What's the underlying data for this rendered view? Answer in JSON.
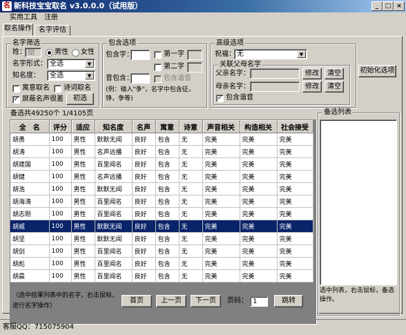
{
  "window": {
    "title": "新科技宝宝取名 v3.0.0.0（试用版）",
    "app_icon": "baby-name-app-icon",
    "minimize_glyph": "_",
    "maximize_glyph": "□",
    "close_glyph": "×"
  },
  "menu": [
    "实用工具",
    "注册"
  ],
  "tabs": [
    "取名操作",
    "名字评估"
  ],
  "name_filter": {
    "group_label": "名字筛选",
    "surname_label": "姓：",
    "surname_value": "胡",
    "gender_male": "男性",
    "gender_female": "女性",
    "gender_selected": "男性",
    "form_label": "名字形式：",
    "form_value": "全选",
    "fame_label": "知名度：",
    "fame_value": "全选",
    "meaning_check": "寓意取名",
    "poem_check": "诗词取名",
    "block_check": "屏蔽名声很差",
    "block_checked": true,
    "initial_button": "初选"
  },
  "include": {
    "group_label": "包含选项",
    "contain_label": "包含字：",
    "contain_value": "",
    "first_char": "第一字",
    "second_char": "第二字",
    "include_homophone": "包含谐音",
    "pinyin_label": "音包含：",
    "pinyin_value": "",
    "example": "(例：输入\"争\"，名字中包含征，铮，争等)"
  },
  "advanced": {
    "group_label": "高级选项",
    "fortune_label": "祝福：",
    "fortune_value": "无",
    "parents_group": "关联父母名字",
    "father_label": "父亲名字：",
    "father_value": "",
    "mother_label": "母亲名字：",
    "mother_value": "",
    "modify_button": "修改",
    "clear_button": "清空",
    "homophone_check": "包含谐音",
    "homophone_checked": true
  },
  "init_button": "初始化选项",
  "candidates": {
    "group_label": "备选共49250个 1/4105页",
    "columns": [
      "全　名",
      "评分",
      "适应",
      "知名度",
      "名声",
      "寓意",
      "诗意",
      "声音相关",
      "构造相关",
      "社会接受"
    ],
    "rows": [
      [
        "胡勇",
        "100",
        "男性",
        "默默无闻",
        "良好",
        "包含",
        "无",
        "完美",
        "完美",
        "完美"
      ],
      [
        "胡涛",
        "100",
        "男性",
        "名声远播",
        "良好",
        "包含",
        "无",
        "完美",
        "完美",
        "完美"
      ],
      [
        "胡建国",
        "100",
        "男性",
        "百里闻名",
        "良好",
        "包含",
        "无",
        "完美",
        "完美",
        "完美"
      ],
      [
        "胡健",
        "100",
        "男性",
        "名声远播",
        "良好",
        "包含",
        "无",
        "完美",
        "完美",
        "完美"
      ],
      [
        "胡浩",
        "100",
        "男性",
        "默默无闻",
        "良好",
        "包含",
        "无",
        "完美",
        "完美",
        "完美"
      ],
      [
        "胡海涛",
        "100",
        "男性",
        "百里闻名",
        "良好",
        "包含",
        "无",
        "完美",
        "完美",
        "完美"
      ],
      [
        "胡志刚",
        "100",
        "男性",
        "百里闻名",
        "良好",
        "包含",
        "无",
        "完美",
        "完美",
        "完美"
      ],
      [
        "胡威",
        "100",
        "男性",
        "默默无闻",
        "良好",
        "包含",
        "无",
        "完美",
        "完美",
        "完美"
      ],
      [
        "胡坚",
        "100",
        "男性",
        "默默无闻",
        "良好",
        "包含",
        "无",
        "完美",
        "完美",
        "完美"
      ],
      [
        "胡剑",
        "100",
        "男性",
        "百里闻名",
        "良好",
        "包含",
        "无",
        "完美",
        "完美",
        "完美"
      ],
      [
        "胡彪",
        "100",
        "男性",
        "百里闻名",
        "良好",
        "包含",
        "无",
        "完美",
        "完美",
        "完美"
      ],
      [
        "胡晨",
        "100",
        "男性",
        "百里闻名",
        "良好",
        "包含",
        "无",
        "完美",
        "完美",
        "完美"
      ]
    ],
    "selected_row": 7,
    "hint": "（选中结果列表中的名字，右击鼠标，进行名字操作）",
    "first_page": "首页",
    "prev_page": "上一页",
    "next_page": "下一页",
    "page_label": "页码：",
    "page_value": "1",
    "goto_button": "跳转"
  },
  "shortlist": {
    "group_label": "备选列表",
    "hint": "选中列表，右击鼠标，备选操作。"
  },
  "status": "客服QQ：715075904"
}
